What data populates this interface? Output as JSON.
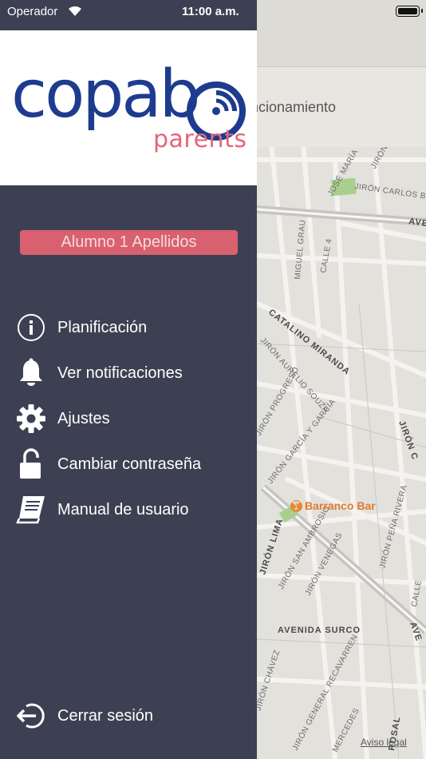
{
  "status_bar": {
    "carrier": "Operador",
    "time": "11:00 a.m."
  },
  "brand": {
    "name": "copab",
    "tagline": "parents",
    "primary_color": "#1d3b8f",
    "accent_color": "#e5647a"
  },
  "student": {
    "name": "Alumno 1 Apellidos"
  },
  "menu": [
    {
      "label": "Planificación",
      "icon": "info-icon"
    },
    {
      "label": "Ver notificaciones",
      "icon": "bell-icon"
    },
    {
      "label": "Ajustes",
      "icon": "gear-icon"
    },
    {
      "label": "Cambiar contraseña",
      "icon": "unlock-icon"
    },
    {
      "label": "Manual de usuario",
      "icon": "book-icon"
    }
  ],
  "logout": {
    "label": "Cerrar sesión",
    "icon": "logout-icon"
  },
  "map": {
    "header_text": "ncionamiento",
    "poi": "Barranco Bar",
    "legal": "Aviso legal",
    "streets": [
      "JOSÉ MARÍA",
      "JIRÓN",
      "JIRÓN CARLOS BA",
      "AVE",
      "MIGUEL GRAU",
      "CALLE 4",
      "CATALINO MIRANDA",
      "JIRÓN AURELIO SOUZA",
      "JIRÓN PROGRESO",
      "JIRÓN GARCÍA Y GARCÍA",
      "JIRÓN C",
      "JIRÓN PEÑA RIVERA",
      "JIRÓN LIMA",
      "JIRÓN SAN AMBROSIO",
      "JIRÓN VENEGAS",
      "AVENIDA SURCO",
      "AVE",
      "JIRÓN CHÁVEZ",
      "JIRÓN GENERAL RECAVARREN",
      "MERCEDES",
      "ROSAL",
      "CALLE"
    ]
  }
}
